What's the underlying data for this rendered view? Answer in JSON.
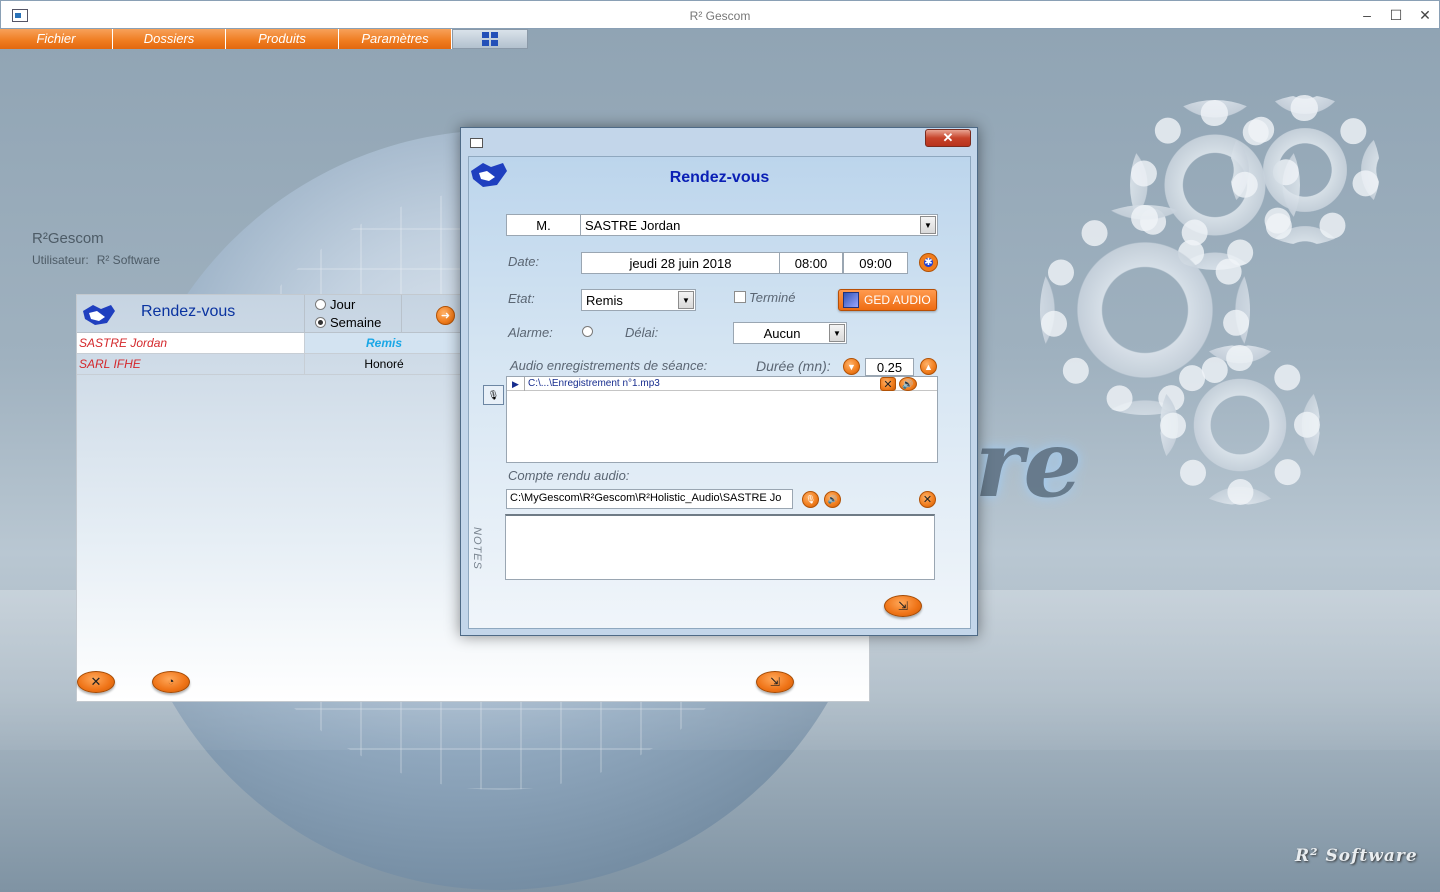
{
  "window": {
    "title": "R² Gescom",
    "minimize": "–",
    "maximize": "☐",
    "close": "✕"
  },
  "menu": {
    "items": [
      "Fichier",
      "Dossiers",
      "Produits",
      "Paramètres"
    ]
  },
  "app_info": {
    "name": "R²Gescom",
    "user_label": "Utilisateur:",
    "user_value": "R² Software"
  },
  "background": {
    "watermark": "re",
    "brand": "R² Software"
  },
  "list_window": {
    "title": "Rendez-vous",
    "radio_jour": "Jour",
    "radio_semaine": "Semaine",
    "selected": "Semaine",
    "rows": [
      {
        "name": "SASTRE Jordan",
        "status": "Remis"
      },
      {
        "name": "SARL IFHE",
        "status": "Honoré"
      }
    ]
  },
  "dialog": {
    "title": "Rendez-vous",
    "close": "✕",
    "civility": "M.",
    "contact": "SASTRE Jordan",
    "date_label": "Date:",
    "date_value": "jeudi 28 juin 2018",
    "time_start": "08:00",
    "time_end": "09:00",
    "etat_label": "Etat:",
    "etat_value": "Remis",
    "termine_label": "Terminé",
    "ged_audio": "GED AUDIO",
    "alarme_label": "Alarme:",
    "delai_label": "Délai:",
    "delai_value": "Aucun",
    "audio_label": "Audio enregistrements de séance:",
    "duree_label": "Durée (mn):",
    "duree_value": "0.25",
    "recordings": [
      {
        "path": "C:\\...\\Enregistrement n°1.mp3"
      }
    ],
    "compte_rendu_label": "Compte rendu audio:",
    "compte_rendu_path": "C:\\MyGescom\\R²Gescom\\R²Holistic_Audio\\SASTRE Jo",
    "notes_label": "NOTES",
    "notes_value": ""
  },
  "colors": {
    "accent_orange": "#ef7b1f",
    "title_blue": "#0a1fb5",
    "name_red": "#d4282c",
    "remis_blue": "#1aa7e6"
  }
}
